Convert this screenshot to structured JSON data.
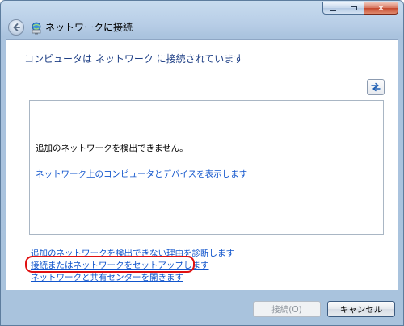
{
  "window": {
    "title": "ネットワークに接続",
    "buttons": {
      "minimize": "minimize-icon",
      "maximize": "maximize-icon",
      "close": "close-icon"
    }
  },
  "status": {
    "heading": "コンピュータは ネットワーク に接続されています"
  },
  "network_box": {
    "message": "追加のネットワークを検出できません。",
    "show_computers_link": "ネットワーク上のコンピュータとデバイスを表示します"
  },
  "task_links": [
    "追加のネットワークを検出できない理由を診断します",
    "接続またはネットワークをセットアップします",
    "ネットワークと共有センターを開きます"
  ],
  "buttons": {
    "connect": "接続(O)",
    "cancel": "キャンセル"
  },
  "colors": {
    "link": "#1155cc",
    "heading": "#1e3f85",
    "highlight": "#e01010"
  }
}
